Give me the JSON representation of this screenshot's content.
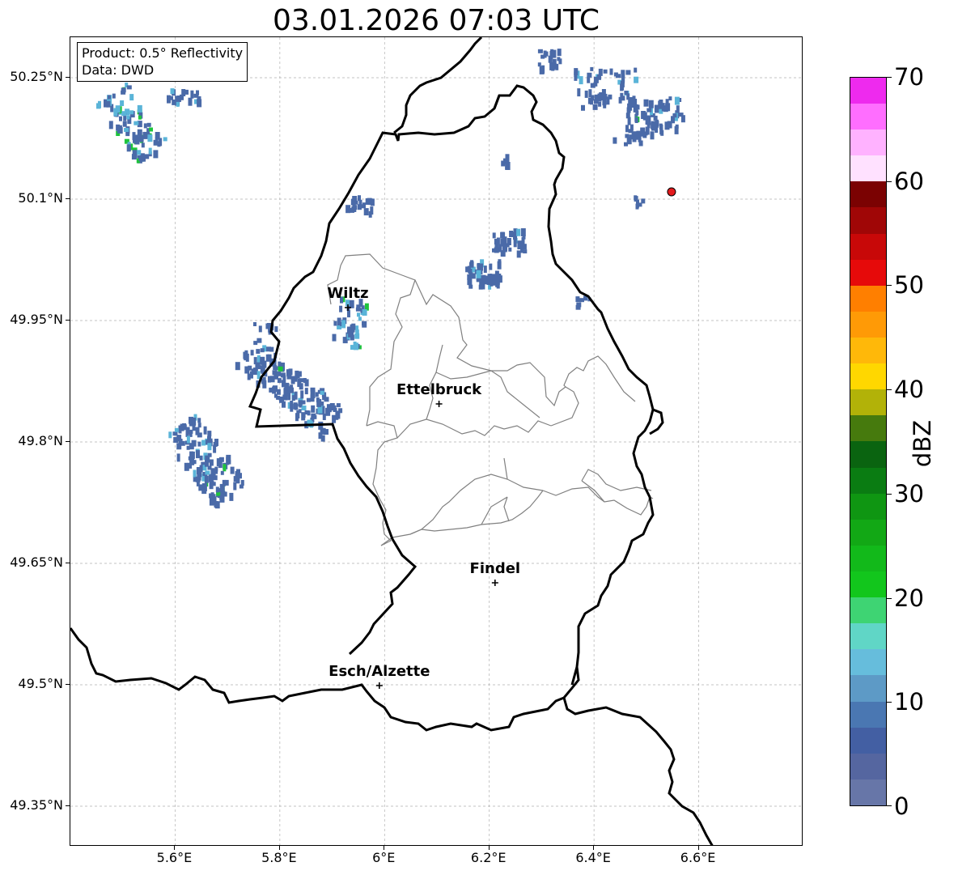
{
  "title": "03.01.2026 07:03 UTC",
  "info": {
    "product": "Product: 0.5° Reflectivity",
    "data": "Data: DWD"
  },
  "axes": {
    "y_ticks": [
      "50.25°N",
      "50.1°N",
      "49.95°N",
      "49.8°N",
      "49.65°N",
      "49.5°N",
      "49.35°N"
    ],
    "x_ticks": [
      "5.6°E",
      "5.8°E",
      "6°E",
      "6.2°E",
      "6.4°E",
      "6.6°E"
    ],
    "lon_range": [
      5.4,
      6.8
    ],
    "lat_range": [
      49.3,
      50.3
    ]
  },
  "cities": [
    {
      "name": "Wiltz",
      "lon": 5.93,
      "lat": 49.966
    },
    {
      "name": "Ettelbruck",
      "lon": 6.104,
      "lat": 49.847
    },
    {
      "name": "Findel",
      "lon": 6.211,
      "lat": 49.626
    },
    {
      "name": "Esch/Alzette",
      "lon": 5.99,
      "lat": 49.499
    }
  ],
  "radar_site": {
    "lon": 6.548,
    "lat": 50.109,
    "color": "#e31a1c"
  },
  "colorbar": {
    "unit": "dBZ",
    "min": 0,
    "max": 70,
    "tick_labels": [
      "0",
      "10",
      "20",
      "30",
      "40",
      "50",
      "60",
      "70"
    ],
    "colors": [
      "#6776a8",
      "#5566a0",
      "#435fa3",
      "#4a77b2",
      "#5d9ac6",
      "#66bddc",
      "#60d6c6",
      "#3ed473",
      "#12c61c",
      "#12b91a",
      "#12a815",
      "#0f9612",
      "#0a7c12",
      "#0a6410",
      "#467a0d",
      "#b2b208",
      "#ffd700",
      "#ffb809",
      "#ff9a06",
      "#ff7f00",
      "#e60a0a",
      "#c80808",
      "#a00606",
      "#7b0202",
      "#ffe1ff",
      "#ffb2ff",
      "#ff6eff",
      "#ee2aee"
    ]
  },
  "colors": {
    "border": "#000000",
    "cantons": "#808080",
    "grid": "#b0b0b0",
    "echo_weak": "#4a6aa8",
    "echo_mid": "#5ab4d8",
    "echo_strong": "#1ec43c"
  }
}
